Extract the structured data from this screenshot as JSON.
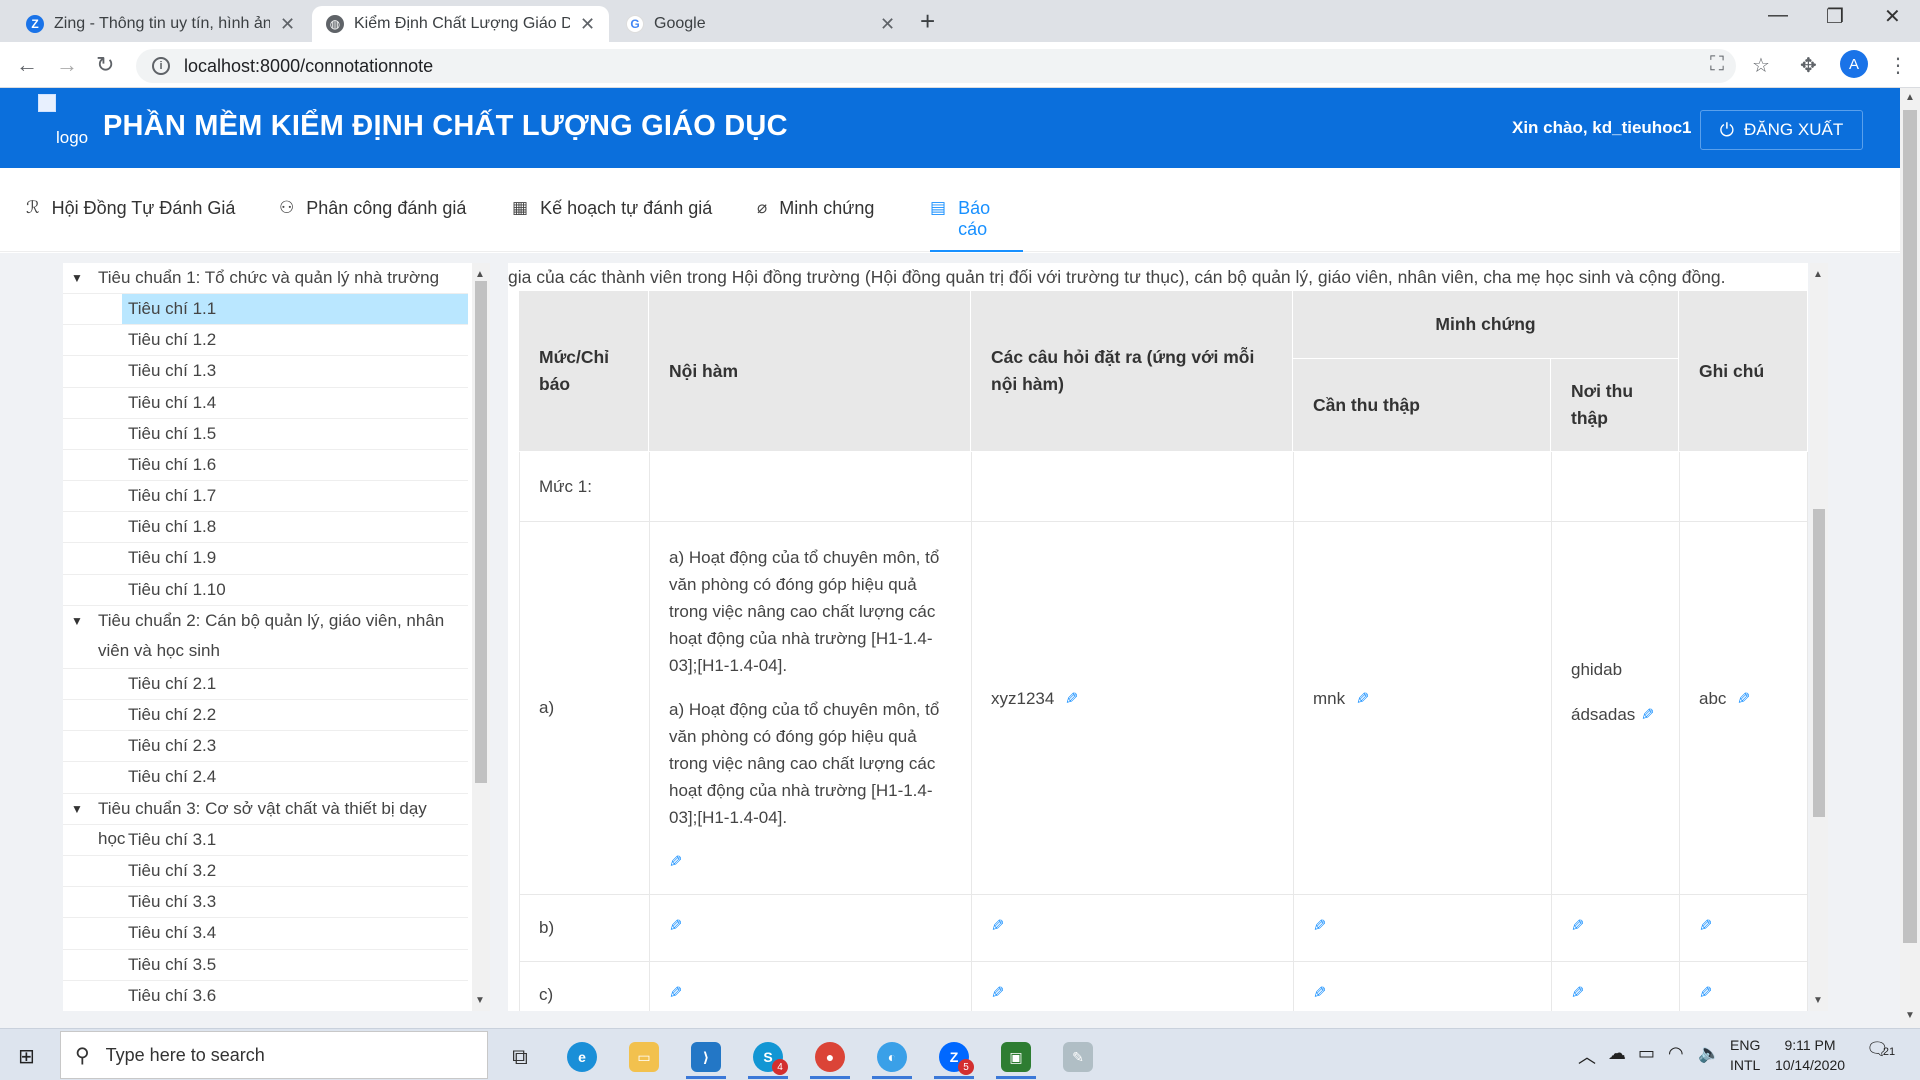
{
  "browser": {
    "tabs": [
      {
        "title": "Zing - Thông tin uy tín, hình ảnh",
        "active": false
      },
      {
        "title": "Kiểm Định Chất Lượng Giáo Dục",
        "active": true
      },
      {
        "title": "Google",
        "active": false
      }
    ],
    "url": "localhost:8000/connotationnote",
    "profile_initial": "A"
  },
  "app": {
    "logo_alt": "logo",
    "title": "PHẦN MỀM KIỂM ĐỊNH CHẤT LƯỢNG GIÁO DỤC",
    "greeting": "Xin chào, kd_tieuhoc1",
    "logout_label": "ĐĂNG XUẤT"
  },
  "nav": [
    {
      "label": "Hội Đồng Tự Đánh Giá",
      "icon": "team-icon"
    },
    {
      "label": "Phân công đánh giá",
      "icon": "cluster-icon"
    },
    {
      "label": "Kế hoạch tự đánh giá",
      "icon": "calendar-icon"
    },
    {
      "label": "Minh chứng",
      "icon": "paperclip-icon"
    },
    {
      "label": "Báo cáo",
      "icon": "report-icon",
      "active": true
    }
  ],
  "tree": {
    "groups": [
      {
        "label": "Tiêu chuẩn 1: Tổ chức và quản lý nhà trường",
        "items": [
          "Tiêu chí 1.1",
          "Tiêu chí 1.2",
          "Tiêu chí 1.3",
          "Tiêu chí 1.4",
          "Tiêu chí 1.5",
          "Tiêu chí 1.6",
          "Tiêu chí 1.7",
          "Tiêu chí 1.8",
          "Tiêu chí 1.9",
          "Tiêu chí 1.10"
        ]
      },
      {
        "label": "Tiêu chuẩn 2: Cán bộ quản lý, giáo viên, nhân viên và học sinh",
        "items": [
          "Tiêu chí 2.1",
          "Tiêu chí 2.2",
          "Tiêu chí 2.3",
          "Tiêu chí 2.4"
        ]
      },
      {
        "label": "Tiêu chuẩn 3: Cơ sở vật chất và thiết bị dạy học",
        "items": [
          "Tiêu chí 3.1",
          "Tiêu chí 3.2",
          "Tiêu chí 3.3",
          "Tiêu chí 3.4",
          "Tiêu chí 3.5",
          "Tiêu chí 3.6"
        ]
      }
    ],
    "selected": "Tiêu chí 1.1"
  },
  "panel": {
    "intro": "gia của các thành viên trong Hội đồng trường (Hội đồng quản trị đối với trường tư thục), cán bộ quản lý, giáo viên, nhân viên, cha mẹ học sinh và cộng đồng.",
    "headers": {
      "level": "Mức/Chỉ báo",
      "content": "Nội hàm",
      "questions": "Các câu hỏi đặt ra (ứng với mỗi nội hàm)",
      "evidence": "Minh chứng",
      "need": "Cần thu thập",
      "where": "Nơi thu thập",
      "note": "Ghi chú"
    },
    "rows": [
      {
        "level": "Mức 1:"
      },
      {
        "level": "a)",
        "content": [
          "a) Hoạt động của tổ chuyên môn, tổ văn phòng có đóng góp hiệu quả trong việc nâng cao chất lượng các hoạt động của nhà trường [H1-1.4-03];[H1-1.4-04].",
          "a) Hoạt động của tổ chuyên môn, tổ văn phòng có đóng góp hiệu quả trong việc nâng cao chất lượng các hoạt động của nhà trường [H1-1.4-03];[H1-1.4-04]."
        ],
        "questions": "xyz1234",
        "need": "mnk",
        "where": [
          "ghidab",
          "ádsadas"
        ],
        "note": "abc"
      },
      {
        "level": "b)"
      },
      {
        "level": "c)"
      }
    ]
  },
  "taskbar": {
    "search_placeholder": "Type here to search",
    "lang_top": "ENG",
    "lang_bottom": "INTL",
    "time": "9:11 PM",
    "date": "10/14/2020",
    "notif_count": "21",
    "skype_badge": "4",
    "zalo_badge": "5"
  }
}
